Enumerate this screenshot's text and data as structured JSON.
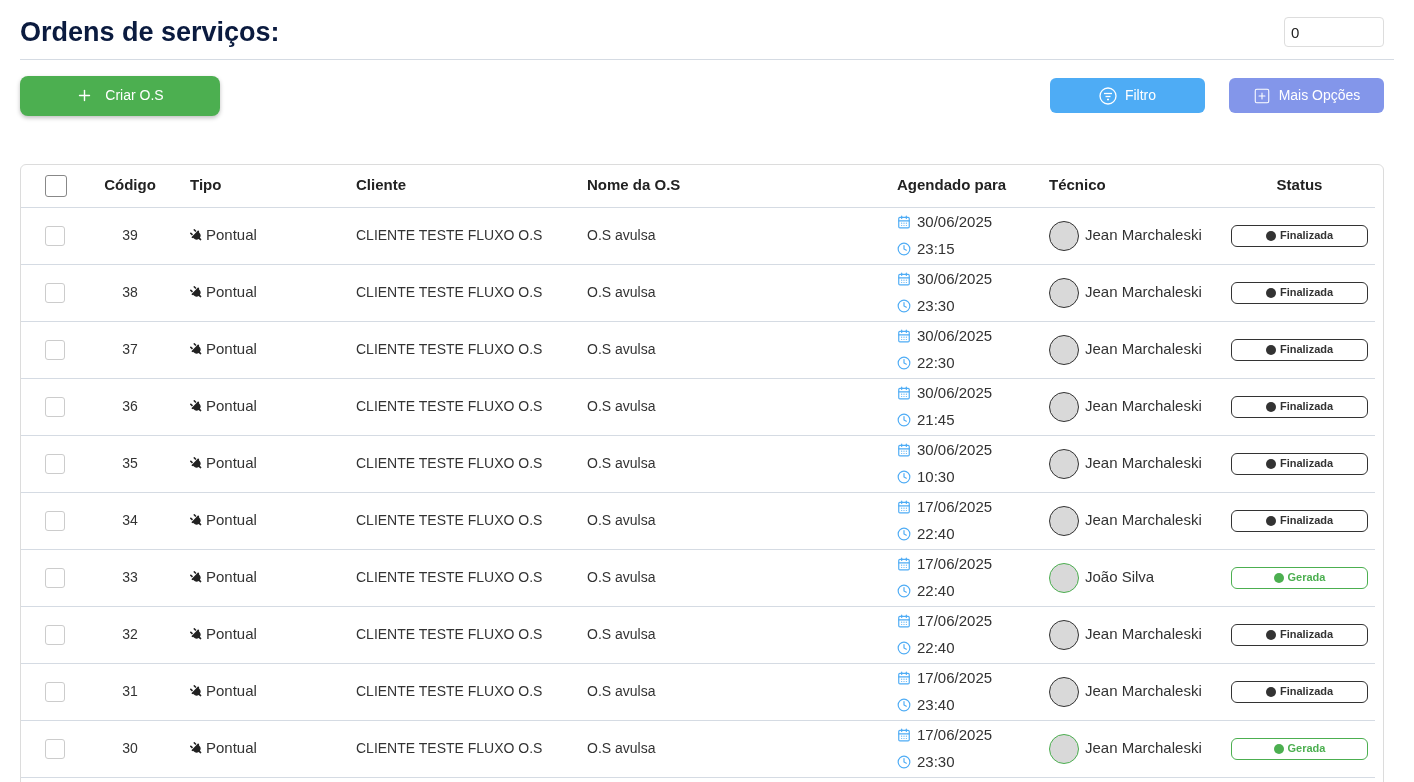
{
  "title": "Ordens de serviços:",
  "counter": {
    "value": "0"
  },
  "actions": {
    "create": "Criar O.S",
    "filter": "Filtro",
    "more": "Mais Opções"
  },
  "table": {
    "select_all": {
      "checked": false
    },
    "columns": [
      "Código",
      "Tipo",
      "Cliente",
      "Nome da O.S",
      "Agendado para",
      "Técnico",
      "Status"
    ],
    "rows": [
      {
        "checked": false,
        "code": "39",
        "type": "Pontual",
        "client": "CLIENTE TESTE FLUXO O.S",
        "name": "O.S avulsa",
        "date": "30/06/2025",
        "time": "23:15",
        "technician": "Jean Marchaleski",
        "status": {
          "label": "Finalizada",
          "kind": "finalizada"
        }
      },
      {
        "checked": false,
        "code": "38",
        "type": "Pontual",
        "client": "CLIENTE TESTE FLUXO O.S",
        "name": "O.S avulsa",
        "date": "30/06/2025",
        "time": "23:30",
        "technician": "Jean Marchaleski",
        "status": {
          "label": "Finalizada",
          "kind": "finalizada"
        }
      },
      {
        "checked": false,
        "code": "37",
        "type": "Pontual",
        "client": "CLIENTE TESTE FLUXO O.S",
        "name": "O.S avulsa",
        "date": "30/06/2025",
        "time": "22:30",
        "technician": "Jean Marchaleski",
        "status": {
          "label": "Finalizada",
          "kind": "finalizada"
        }
      },
      {
        "checked": false,
        "code": "36",
        "type": "Pontual",
        "client": "CLIENTE TESTE FLUXO O.S",
        "name": "O.S avulsa",
        "date": "30/06/2025",
        "time": "21:45",
        "technician": "Jean Marchaleski",
        "status": {
          "label": "Finalizada",
          "kind": "finalizada"
        }
      },
      {
        "checked": false,
        "code": "35",
        "type": "Pontual",
        "client": "CLIENTE TESTE FLUXO O.S",
        "name": "O.S avulsa",
        "date": "30/06/2025",
        "time": "10:30",
        "technician": "Jean Marchaleski",
        "status": {
          "label": "Finalizada",
          "kind": "finalizada"
        }
      },
      {
        "checked": false,
        "code": "34",
        "type": "Pontual",
        "client": "CLIENTE TESTE FLUXO O.S",
        "name": "O.S avulsa",
        "date": "17/06/2025",
        "time": "22:40",
        "technician": "Jean Marchaleski",
        "status": {
          "label": "Finalizada",
          "kind": "finalizada"
        }
      },
      {
        "checked": false,
        "code": "33",
        "type": "Pontual",
        "client": "CLIENTE TESTE FLUXO O.S",
        "name": "O.S avulsa",
        "date": "17/06/2025",
        "time": "22:40",
        "technician": "João Silva",
        "status": {
          "label": "Gerada",
          "kind": "gerada"
        }
      },
      {
        "checked": false,
        "code": "32",
        "type": "Pontual",
        "client": "CLIENTE TESTE FLUXO O.S",
        "name": "O.S avulsa",
        "date": "17/06/2025",
        "time": "22:40",
        "technician": "Jean Marchaleski",
        "status": {
          "label": "Finalizada",
          "kind": "finalizada"
        }
      },
      {
        "checked": false,
        "code": "31",
        "type": "Pontual",
        "client": "CLIENTE TESTE FLUXO O.S",
        "name": "O.S avulsa",
        "date": "17/06/2025",
        "time": "23:40",
        "technician": "Jean Marchaleski",
        "status": {
          "label": "Finalizada",
          "kind": "finalizada"
        }
      },
      {
        "checked": false,
        "code": "30",
        "type": "Pontual",
        "client": "CLIENTE TESTE FLUXO O.S",
        "name": "O.S avulsa",
        "date": "17/06/2025",
        "time": "23:30",
        "technician": "Jean Marchaleski",
        "status": {
          "label": "Gerada",
          "kind": "gerada"
        }
      }
    ]
  }
}
